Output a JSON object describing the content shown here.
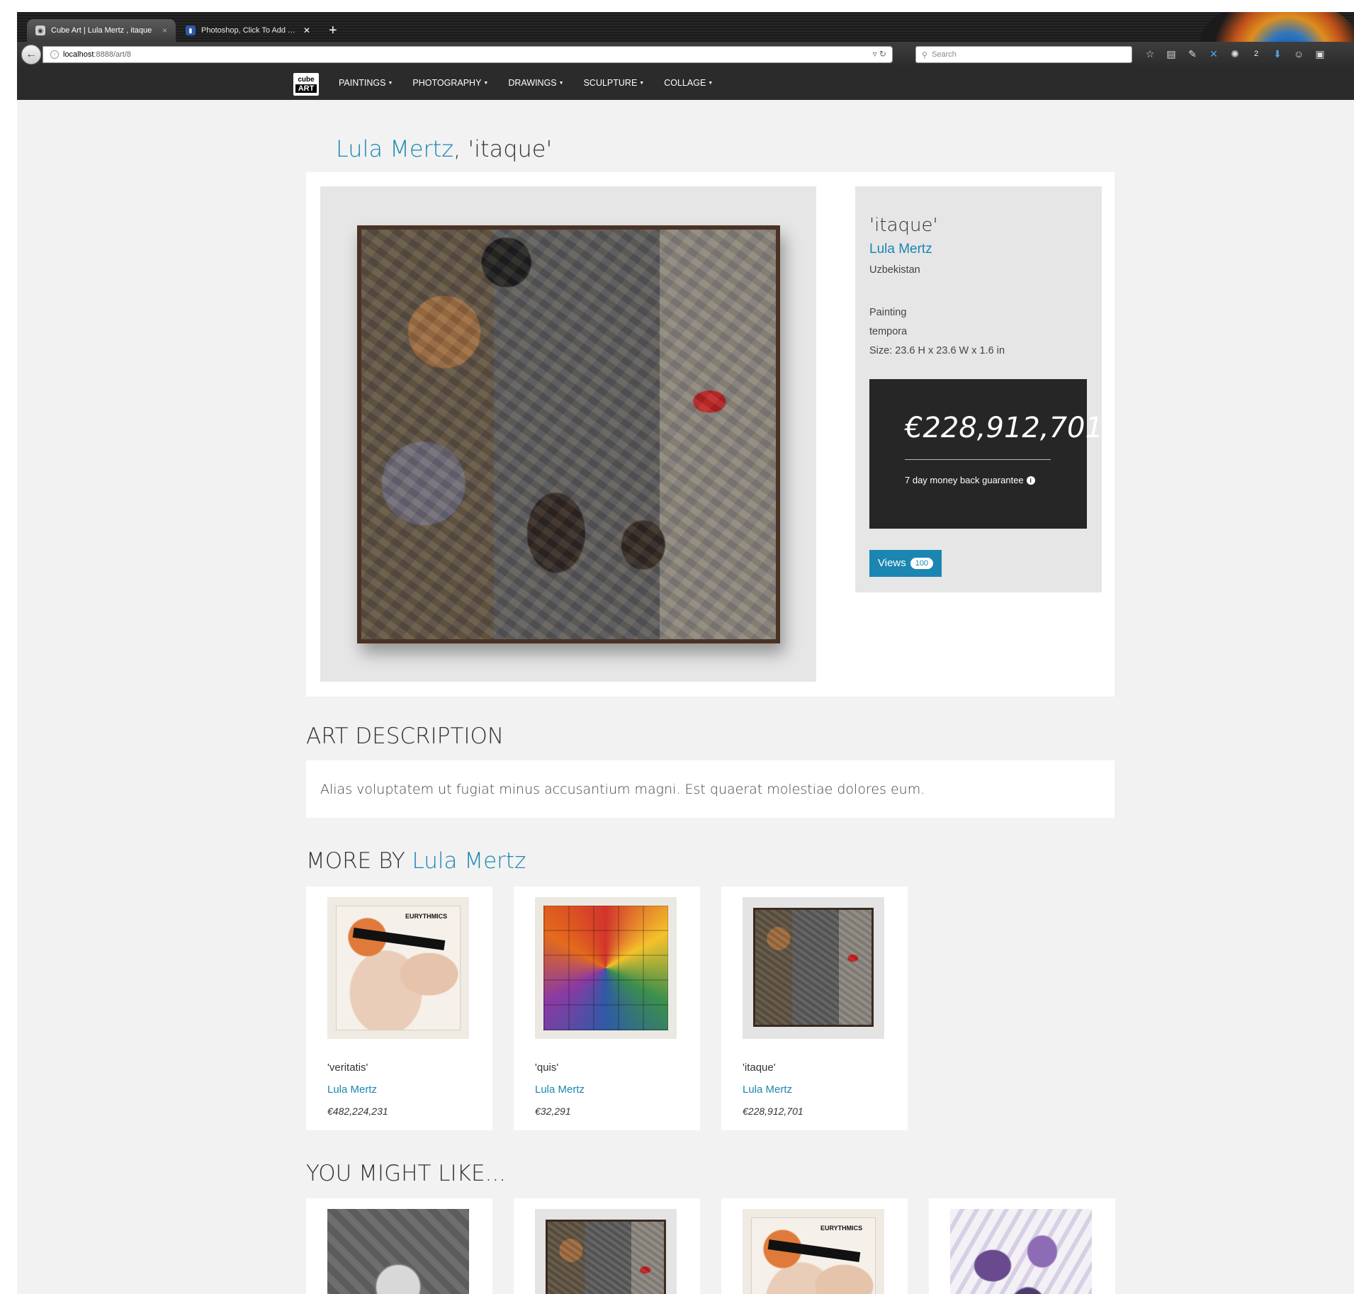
{
  "browser": {
    "tabs": [
      {
        "label": "Cube Art | Lula Mertz , itaque",
        "active": true,
        "close": "×"
      },
      {
        "label": "Photoshop, Click To Add Te...",
        "active": false,
        "close": "✕"
      }
    ],
    "new_tab": "+",
    "back_glyph": "←",
    "url_host": "localhost",
    "url_path": ":8888/art/8",
    "url_right_glyphs": "▿ ↻",
    "search_placeholder": "Search",
    "toolbar_icons": [
      "star-icon",
      "reading-list-icon",
      "tools-icon",
      "extension-x-icon",
      "fox-icon",
      "download-arrow-icon",
      "chat-icon",
      "pdf-icon"
    ],
    "toolbar_badge": "2"
  },
  "site_nav": {
    "brand_top": "cube",
    "brand_bottom": "ART",
    "menu": [
      "PAINTINGS",
      "PHOTOGRAPHY",
      "DRAWINGS",
      "SCULPTURE",
      "COLLAGE"
    ]
  },
  "page": {
    "title_artist": "Lula Mertz",
    "title_work": ", 'itaque'"
  },
  "artwork": {
    "title": "'itaque'",
    "artist": "Lula Mertz",
    "country": "Uzbekistan",
    "type": "Painting",
    "medium": "tempora",
    "size": "Size: 23.6 H x 23.6 W x 1.6 in",
    "price": "€228,912,701",
    "guarantee": "7 day money back guarantee",
    "views_label": "Views",
    "views_count": "100"
  },
  "description": {
    "heading": "ART DESCRIPTION",
    "text": "Alias voluptatem ut fugiat minus accusantium magni. Est quaerat molestiae dolores eum."
  },
  "more_by": {
    "heading_prefix": "MORE BY ",
    "heading_artist": "Lula Mertz",
    "items": [
      {
        "title": "'veritatis'",
        "artist": "Lula Mertz",
        "price": "€482,224,231",
        "logo": "EURYTHMICS"
      },
      {
        "title": "'quis'",
        "artist": "Lula Mertz",
        "price": "€32,291"
      },
      {
        "title": "'itaque'",
        "artist": "Lula Mertz",
        "price": "€228,912,701"
      }
    ]
  },
  "you_might_like": {
    "heading": "YOU MIGHT LIKE..."
  },
  "colors": {
    "accent": "#1b86b1",
    "navbar": "#2b2b2b",
    "page_bg": "#f2f2f2",
    "price_box": "#262626"
  }
}
